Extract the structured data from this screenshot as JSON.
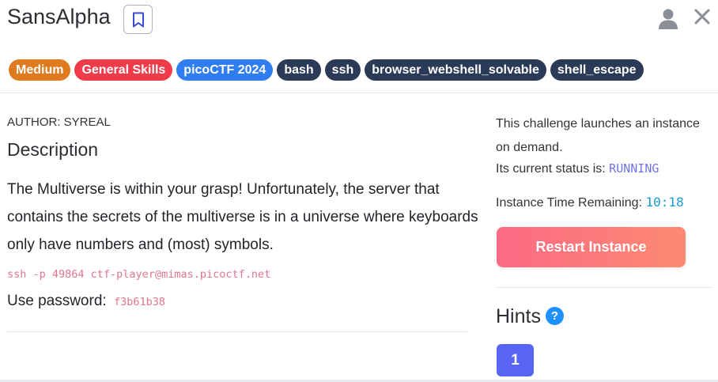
{
  "challenge": {
    "title": "SansAlpha",
    "tags": [
      {
        "label": "Medium",
        "color": "#e07a1f"
      },
      {
        "label": "General Skills",
        "color": "#ef3b4a"
      },
      {
        "label": "picoCTF 2024",
        "color": "#2f7df0"
      },
      {
        "label": "bash",
        "color": "#2b3a56"
      },
      {
        "label": "ssh",
        "color": "#2b3a56"
      },
      {
        "label": "browser_webshell_solvable",
        "color": "#2b3a56"
      },
      {
        "label": "shell_escape",
        "color": "#2b3a56"
      }
    ],
    "author": "AUTHOR: SYREAL",
    "description_heading": "Description",
    "description": "The Multiverse is within your grasp! Unfortunately, the server that contains the secrets of the multiverse is in a universe where keyboards only have numbers and (most) symbols.",
    "ssh_command": "ssh -p 49864 ctf-player@mimas.picoctf.net",
    "password_label": "Use password:",
    "password_value": "f3b61b38"
  },
  "instance": {
    "intro": "This challenge launches an instance on demand.",
    "status_label": "Its current status is:",
    "status_value": "RUNNING",
    "time_label": "Instance Time Remaining:",
    "time_value": "10:18",
    "restart_label": "Restart Instance"
  },
  "hints": {
    "heading": "Hints",
    "help_symbol": "?",
    "buttons": [
      "1"
    ]
  },
  "icons": {
    "bookmark": "bookmark-icon",
    "user": "user-icon",
    "close": "close-icon",
    "help": "help-icon"
  }
}
